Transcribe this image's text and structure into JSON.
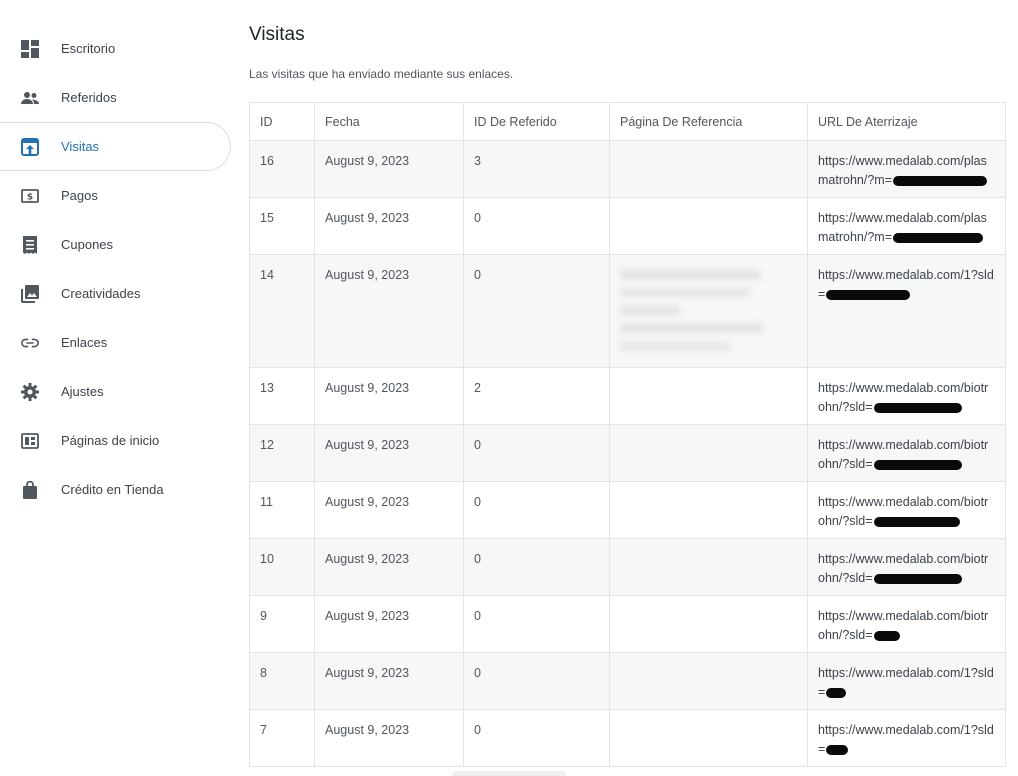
{
  "sidebar": {
    "items": [
      {
        "label": "Escritorio",
        "icon": "dashboard-icon"
      },
      {
        "label": "Referidos",
        "icon": "people-icon"
      },
      {
        "label": "Visitas",
        "icon": "visits-icon"
      },
      {
        "label": "Pagos",
        "icon": "money-icon"
      },
      {
        "label": "Cupones",
        "icon": "coupon-icon"
      },
      {
        "label": "Creatividades",
        "icon": "image-stack-icon"
      },
      {
        "label": "Enlaces",
        "icon": "link-icon"
      },
      {
        "label": "Ajustes",
        "icon": "gear-icon"
      },
      {
        "label": "Páginas de inicio",
        "icon": "landing-page-icon"
      },
      {
        "label": "Crédito en Tienda",
        "icon": "shopping-bag-icon"
      }
    ],
    "active_index": 2,
    "active_color": "#2271b1"
  },
  "main": {
    "title": "Visitas",
    "description": "Las visitas que ha enviado mediante sus enlaces.",
    "table": {
      "headers": [
        "ID",
        "Fecha",
        "ID De Referido",
        "Página De Referencia",
        "URL De Aterrizaje"
      ],
      "rows": [
        {
          "id": "16",
          "date": "August 9, 2023",
          "referral_id": "3",
          "referrer": "",
          "url": "https://www.medalab.com/plasmatrohn/?m="
        },
        {
          "id": "15",
          "date": "August 9, 2023",
          "referral_id": "0",
          "referrer": "",
          "url": "https://www.medalab.com/plasmatrohn/?m="
        },
        {
          "id": "14",
          "date": "August 9, 2023",
          "referral_id": "0",
          "referrer": "",
          "url": "https://www.medalab.com/1?sld="
        },
        {
          "id": "13",
          "date": "August 9, 2023",
          "referral_id": "2",
          "referrer": "",
          "url": "https://www.medalab.com/biotrohn/?sld="
        },
        {
          "id": "12",
          "date": "August 9, 2023",
          "referral_id": "0",
          "referrer": "",
          "url": "https://www.medalab.com/biotrohn/?sld="
        },
        {
          "id": "11",
          "date": "August 9, 2023",
          "referral_id": "0",
          "referrer": "",
          "url": "https://www.medalab.com/biotrohn/?sld="
        },
        {
          "id": "10",
          "date": "August 9, 2023",
          "referral_id": "0",
          "referrer": "",
          "url": "https://www.medalab.com/biotrohn/?sld="
        },
        {
          "id": "9",
          "date": "August 9, 2023",
          "referral_id": "0",
          "referrer": "",
          "url": "https://www.medalab.com/biotrohn/?sld="
        },
        {
          "id": "8",
          "date": "August 9, 2023",
          "referral_id": "0",
          "referrer": "",
          "url": "https://www.medalab.com/1?sld="
        },
        {
          "id": "7",
          "date": "August 9, 2023",
          "referral_id": "0",
          "referrer": "",
          "url": "https://www.medalab.com/1?sld="
        }
      ]
    }
  }
}
